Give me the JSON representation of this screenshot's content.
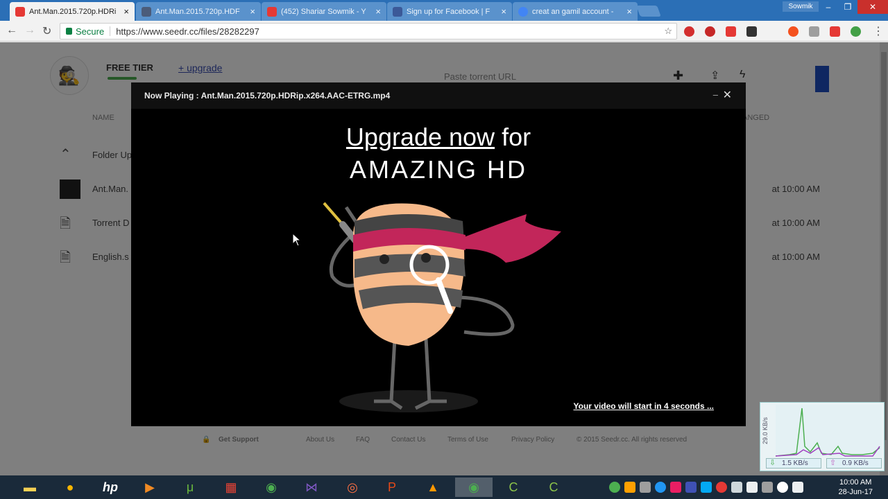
{
  "browser": {
    "tabs": [
      {
        "title": "Ant.Man.2015.720p.HDRi",
        "favicon_color": "#e53935",
        "active": true
      },
      {
        "title": "Ant.Man.2015.720p.HDF",
        "favicon_color": "#4b5c7a",
        "active": false
      },
      {
        "title": "(452) Shariar Sowmik - Y",
        "favicon_color": "#e53935",
        "active": false
      },
      {
        "title": "Sign up for Facebook | F",
        "favicon_color": "#3b5998",
        "active": false
      },
      {
        "title": "creat an gamil account -",
        "favicon_color": "#4285f4",
        "active": false
      }
    ],
    "user_label": "Sowmik",
    "secure_label": "Secure",
    "url": "https://www.seedr.cc/files/28282297"
  },
  "page": {
    "tier": "FREE TIER",
    "upgrade": "+ upgrade",
    "paste_placeholder": "Paste torrent URL",
    "columns": {
      "name": "NAME",
      "changed": "ANGED"
    },
    "rows": [
      {
        "name": "Folder Up",
        "icon": "folder-up-icon",
        "date": ""
      },
      {
        "name": "Ant.Man.",
        "icon": "video-thumbnail",
        "date": "at 10:00 AM"
      },
      {
        "name": "Torrent D",
        "icon": "document-icon",
        "date": "at 10:00 AM"
      },
      {
        "name": "English.s",
        "icon": "document-icon",
        "date": "at 10:00 AM"
      }
    ],
    "footer": {
      "support": "Get Support",
      "links": [
        "About Us",
        "FAQ",
        "Contact Us",
        "Terms of Use",
        "Privacy Policy"
      ],
      "copyright": "© 2015 Seedr.cc. All rights reserved"
    }
  },
  "player": {
    "title": "Now Playing : Ant.Man.2015.720p.HDRip.x264.AAC-ETRG.mp4",
    "promo_link": "Upgrade now",
    "promo_rest": " for",
    "promo_line2": "AMAZING HD",
    "countdown": "Your video will start in 4 seconds ..."
  },
  "netmeter": {
    "axis_label": "29.0 KB/s",
    "download": "1.5 KB/s",
    "upload": "0.9 KB/s"
  },
  "taskbar": {
    "time": "10:00 AM",
    "date": "28-Jun-17"
  },
  "colors": {
    "accent": "#3a4fb3",
    "tabstrip": "#2b6fb6",
    "ninja_band": "#c2265a"
  }
}
